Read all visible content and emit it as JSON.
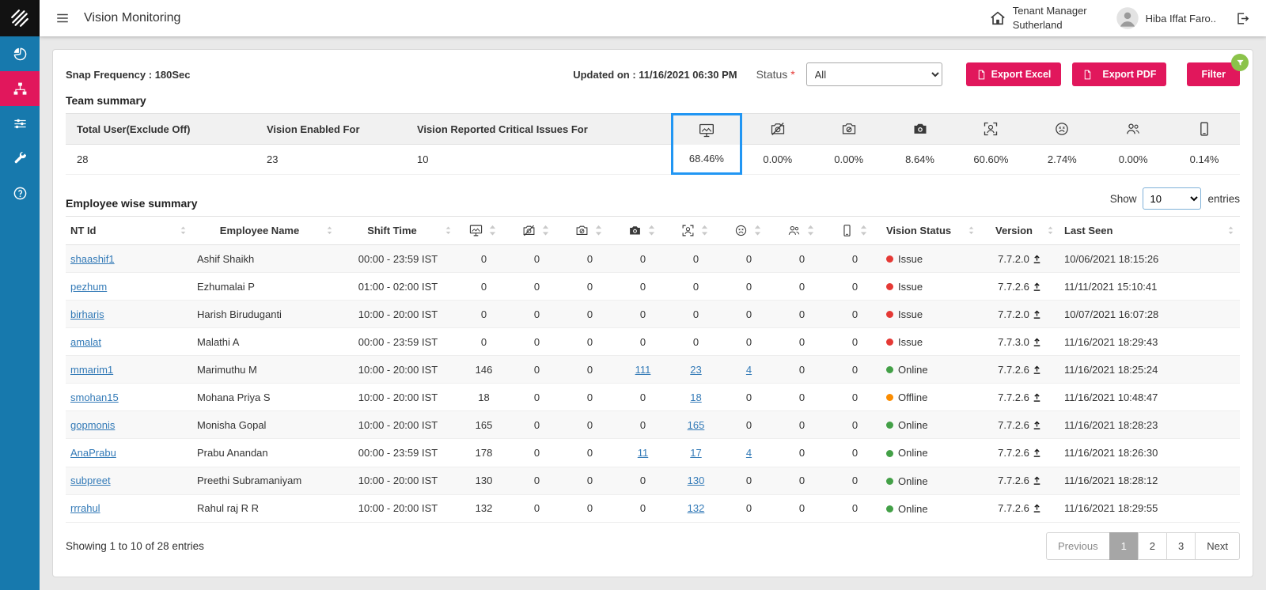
{
  "header": {
    "title": "Vision Monitoring",
    "tenant_role": "Tenant Manager",
    "tenant_name": "Sutherland",
    "user_name": "Hiba Iffat Faro.."
  },
  "toolbar": {
    "snap_frequency": "Snap Frequency : 180Sec",
    "updated_on": "Updated on : 11/16/2021 06:30 PM",
    "status_label": "Status",
    "status_required_mark": "*",
    "status_value": "All",
    "export_excel_label": "Export Excel",
    "export_pdf_label": "Export PDF",
    "filter_label": "Filter"
  },
  "team_summary": {
    "title": "Team summary",
    "text_columns": [
      "Total User(Exclude Off)",
      "Vision Enabled For",
      "Vision Reported Critical Issues For"
    ],
    "icon_columns": [
      "monitor-snapshot-icon",
      "camera-disabled-icon",
      "camera-unavailable-icon",
      "camera-capture-icon",
      "face-scan-icon",
      "face-issue-icon",
      "multiple-persons-icon",
      "mobile-icon"
    ],
    "values": [
      "28",
      "23",
      "10"
    ],
    "icon_values": [
      "68.46%",
      "0.00%",
      "0.00%",
      "8.64%",
      "60.60%",
      "2.74%",
      "0.00%",
      "0.14%"
    ],
    "highlighted_icon_index": 0
  },
  "employee_summary": {
    "title": "Employee wise summary",
    "show_label": "Show",
    "page_size": "10",
    "entries_label": "entries",
    "text_columns": [
      "NT Id",
      "Employee Name",
      "Shift Time"
    ],
    "icon_columns": [
      "monitor-snapshot-icon",
      "camera-disabled-icon",
      "camera-unavailable-icon",
      "camera-capture-icon",
      "face-scan-icon",
      "face-issue-icon",
      "multiple-persons-icon",
      "mobile-icon"
    ],
    "tail_columns": [
      "Vision Status",
      "Version",
      "Last Seen"
    ],
    "rows": [
      {
        "nt_id": "shaashif1",
        "name": "Ashif Shaikh",
        "shift": "00:00 - 23:59 IST",
        "counts": [
          "0",
          "0",
          "0",
          "0",
          "0",
          "0",
          "0",
          "0"
        ],
        "link_indices": [],
        "status": "Issue",
        "version": "7.7.2.0",
        "last_seen": "10/06/2021 18:15:26"
      },
      {
        "nt_id": "pezhum",
        "name": "Ezhumalai P",
        "shift": "01:00 - 02:00 IST",
        "counts": [
          "0",
          "0",
          "0",
          "0",
          "0",
          "0",
          "0",
          "0"
        ],
        "link_indices": [],
        "status": "Issue",
        "version": "7.7.2.6",
        "last_seen": "11/11/2021 15:10:41"
      },
      {
        "nt_id": "birharis",
        "name": "Harish Biruduganti",
        "shift": "10:00 - 20:00 IST",
        "counts": [
          "0",
          "0",
          "0",
          "0",
          "0",
          "0",
          "0",
          "0"
        ],
        "link_indices": [],
        "status": "Issue",
        "version": "7.7.2.0",
        "last_seen": "10/07/2021 16:07:28"
      },
      {
        "nt_id": "amalat",
        "name": "Malathi A",
        "shift": "00:00 - 23:59 IST",
        "counts": [
          "0",
          "0",
          "0",
          "0",
          "0",
          "0",
          "0",
          "0"
        ],
        "link_indices": [],
        "status": "Issue",
        "version": "7.7.3.0",
        "last_seen": "11/16/2021 18:29:43"
      },
      {
        "nt_id": "mmarim1",
        "name": "Marimuthu M",
        "shift": "10:00 - 20:00 IST",
        "counts": [
          "146",
          "0",
          "0",
          "111",
          "23",
          "4",
          "0",
          "0"
        ],
        "link_indices": [
          3,
          4,
          5
        ],
        "status": "Online",
        "version": "7.7.2.6",
        "last_seen": "11/16/2021 18:25:24"
      },
      {
        "nt_id": "smohan15",
        "name": "Mohana Priya S",
        "shift": "10:00 - 20:00 IST",
        "counts": [
          "18",
          "0",
          "0",
          "0",
          "18",
          "0",
          "0",
          "0"
        ],
        "link_indices": [
          4
        ],
        "status": "Offline",
        "version": "7.7.2.6",
        "last_seen": "11/16/2021 10:48:47"
      },
      {
        "nt_id": "gopmonis",
        "name": "Monisha Gopal",
        "shift": "10:00 - 20:00 IST",
        "counts": [
          "165",
          "0",
          "0",
          "0",
          "165",
          "0",
          "0",
          "0"
        ],
        "link_indices": [
          4
        ],
        "status": "Online",
        "version": "7.7.2.6",
        "last_seen": "11/16/2021 18:28:23"
      },
      {
        "nt_id": "AnaPrabu",
        "name": "Prabu Anandan",
        "shift": "00:00 - 23:59 IST",
        "counts": [
          "178",
          "0",
          "0",
          "11",
          "17",
          "4",
          "0",
          "0"
        ],
        "link_indices": [
          3,
          4,
          5
        ],
        "status": "Online",
        "version": "7.7.2.6",
        "last_seen": "11/16/2021 18:26:30"
      },
      {
        "nt_id": "subpreet",
        "name": "Preethi Subramaniyam",
        "shift": "10:00 - 20:00 IST",
        "counts": [
          "130",
          "0",
          "0",
          "0",
          "130",
          "0",
          "0",
          "0"
        ],
        "link_indices": [
          4
        ],
        "status": "Online",
        "version": "7.7.2.6",
        "last_seen": "11/16/2021 18:28:12"
      },
      {
        "nt_id": "rrrahul",
        "name": "Rahul raj R R",
        "shift": "10:00 - 20:00 IST",
        "counts": [
          "132",
          "0",
          "0",
          "0",
          "132",
          "0",
          "0",
          "0"
        ],
        "link_indices": [
          4
        ],
        "status": "Online",
        "version": "7.7.2.6",
        "last_seen": "11/16/2021 18:29:55"
      }
    ]
  },
  "footer": {
    "showing_text": "Showing 1 to 10 of 28 entries",
    "pagination": [
      {
        "label": "Previous",
        "state": "disabled"
      },
      {
        "label": "1",
        "state": "active"
      },
      {
        "label": "2",
        "state": "normal"
      },
      {
        "label": "3",
        "state": "normal"
      },
      {
        "label": "Next",
        "state": "normal"
      }
    ]
  },
  "sidebar": {
    "items": [
      "dashboard",
      "vision-monitoring",
      "settings",
      "tools",
      "help"
    ],
    "active_item": "vision-monitoring"
  },
  "colors": {
    "accent_red": "#e1175c",
    "sidebar_blue": "#1779ad",
    "highlight_blue": "#2196f3",
    "link_blue": "#337ab7",
    "status_issue": "#e53935",
    "status_online": "#43a047",
    "status_offline": "#fb8c00"
  }
}
